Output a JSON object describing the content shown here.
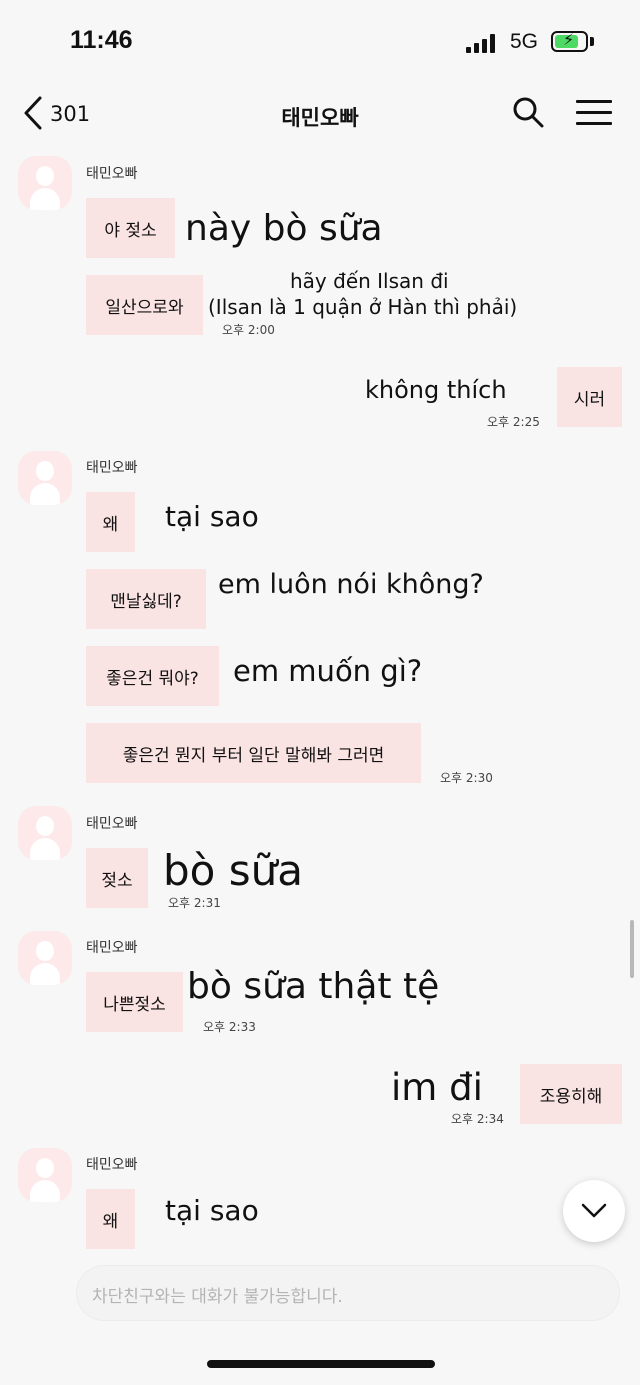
{
  "status_bar": {
    "time": "11:46",
    "network": "5G"
  },
  "header": {
    "back_count": "301",
    "title": "태민오빠"
  },
  "groups": [
    {
      "sender": "태민오빠",
      "messages": [
        {
          "bubble": "야 젖소",
          "caption": "này bò sữa"
        },
        {
          "bubble": "일산으로와",
          "caption_line1": "hãy đến Ilsan đi",
          "caption_line2": "(Ilsan là 1 quận ở Hàn thì phải)",
          "time": "오후 2:00"
        }
      ]
    },
    {
      "outgoing": true,
      "messages": [
        {
          "bubble": "시러",
          "caption": "không thích",
          "time": "오후 2:25"
        }
      ]
    },
    {
      "sender": "태민오빠",
      "messages": [
        {
          "bubble": "왜",
          "caption": "tại sao"
        },
        {
          "bubble": "맨날싫데?",
          "caption": "em luôn nói không?"
        },
        {
          "bubble": "좋은건 뭐야?",
          "caption": "em muốn gì?"
        },
        {
          "bubble": "좋은건 뭔지 부터 일단 말해봐 그러면",
          "time": "오후 2:30"
        }
      ]
    },
    {
      "sender": "태민오빠",
      "messages": [
        {
          "bubble": "젖소",
          "caption": "bò sữa",
          "time": "오후 2:31"
        }
      ]
    },
    {
      "sender": "태민오빠",
      "messages": [
        {
          "bubble": "나쁜젖소",
          "caption": "bò sữa thật tệ",
          "time": "오후 2:33"
        }
      ]
    },
    {
      "outgoing": true,
      "messages": [
        {
          "bubble": "조용히해",
          "caption": "im đi",
          "time": "오후 2:34"
        }
      ]
    },
    {
      "sender": "태민오빠",
      "messages": [
        {
          "bubble": "왜",
          "caption": "tại sao"
        }
      ]
    }
  ],
  "input": {
    "placeholder": "차단친구와는 대화가 불가능합니다."
  },
  "icons": {
    "back": "chevron-left-icon",
    "search": "search-icon",
    "menu": "hamburger-menu-icon",
    "scroll": "chevron-down-icon",
    "avatar": "default-avatar-icon"
  },
  "colors": {
    "background": "#f7f7f7",
    "bubble": "#fae3e3",
    "avatar": "#fde9e9",
    "battery": "#4cd964"
  }
}
